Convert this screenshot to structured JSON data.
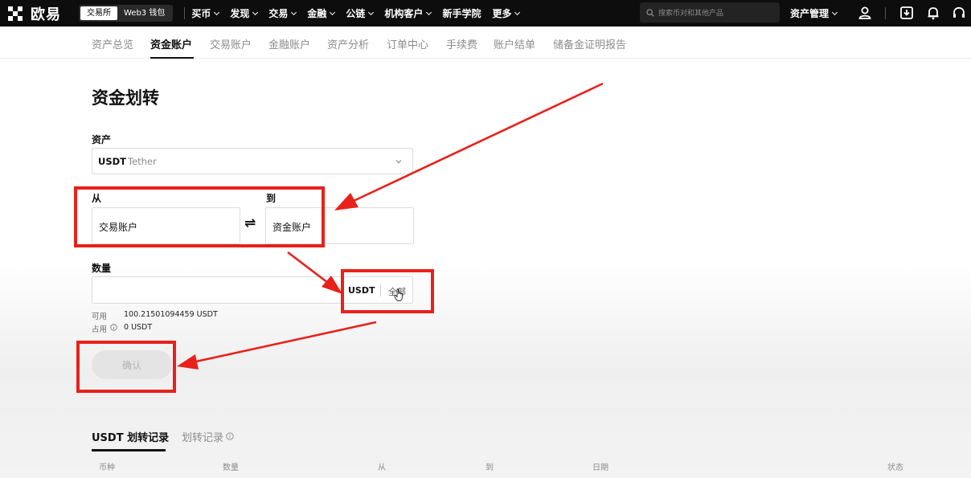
{
  "topbar": {
    "logo_text": "欧易",
    "segments": [
      "交易所",
      "Web3 钱包"
    ],
    "menu": [
      "买币",
      "发现",
      "交易",
      "金融",
      "公链",
      "机构客户",
      "新手学院",
      "更多"
    ],
    "search_placeholder": "搜索币对和其他产品",
    "asset_management": "资产管理"
  },
  "subnav": {
    "items": [
      "资产总览",
      "资金账户",
      "交易账户",
      "金融账户",
      "资产分析",
      "订单中心",
      "手续费",
      "账户结单",
      "储备金证明报告"
    ],
    "active": "资金账户"
  },
  "transfer": {
    "title": "资金划转",
    "asset_label": "资产",
    "asset_symbol": "USDT",
    "asset_name": "Tether",
    "from_label": "从",
    "from_value": "交易账户",
    "to_label": "到",
    "to_value": "资金账户",
    "swap_symbol": "⇌",
    "amount_label": "数量",
    "amount_unit": "USDT",
    "all_label": "全部",
    "available_label": "可用",
    "available_value": "100.21501094459 USDT",
    "occupied_label": "占用",
    "occupied_value": "0 USDT",
    "confirm_label": "确认"
  },
  "records": {
    "tabs": [
      "USDT 划转记录",
      "划转记录"
    ],
    "columns": [
      "币种",
      "数量",
      "从",
      "到",
      "日期",
      "状态"
    ]
  },
  "colors": {
    "annotation_red": "#e8211b",
    "topbar_bg": "#0d0d0d"
  }
}
